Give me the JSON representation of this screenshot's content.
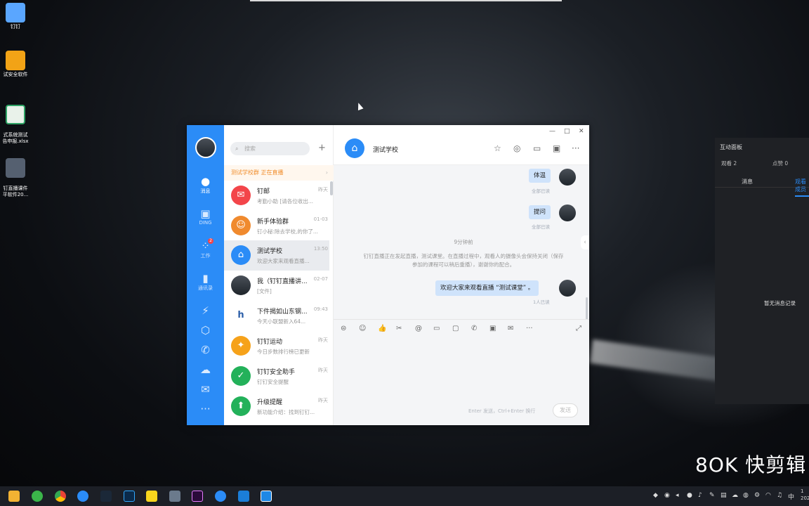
{
  "desktop": {
    "icons": [
      {
        "label": "钉钉",
        "icon": "feather-app-icon",
        "color": "#3a8cf7"
      },
      {
        "label": "试安全软件",
        "icon": "shield-app-icon",
        "color": "#f2a316"
      },
      {
        "label": "式系统测试\n告申报.xlsx",
        "icon": "spreadsheet-icon",
        "color": "#2ea365"
      },
      {
        "label": "钉直播课件\n平软件20...",
        "icon": "video-thumbnail-icon",
        "color": "#556070"
      }
    ]
  },
  "app": {
    "window_controls": {
      "minimize": "—",
      "maximize": "□",
      "close": "✕"
    },
    "rail": {
      "items": [
        {
          "label": "消息",
          "icon": "chat-bubble-icon",
          "active": true
        },
        {
          "label": "DING",
          "icon": "ding-icon",
          "active": false
        },
        {
          "label": "工作",
          "icon": "apps-grid-icon",
          "active": false,
          "badge": "2"
        },
        {
          "label": "通讯录",
          "icon": "contacts-icon",
          "active": false
        },
        {
          "label": "",
          "icon": "lightning-icon"
        },
        {
          "label": "",
          "icon": "hexagon-icon"
        },
        {
          "label": "",
          "icon": "phone-icon"
        },
        {
          "label": "",
          "icon": "cloud-icon"
        },
        {
          "label": "",
          "icon": "mail-icon"
        },
        {
          "label": "",
          "icon": "more-dots-icon"
        }
      ]
    },
    "search": {
      "placeholder": "搜索",
      "plus": "+"
    },
    "live_banner": {
      "text": "测试学校群 正在直播",
      "chevron": "›"
    },
    "conversations": [
      {
        "name": "钉邮",
        "time": "昨天",
        "preview": "考勤小助 [请各位收出...",
        "avatar_color": "#f3454a",
        "icon": "mail-icon",
        "glyph": "✉"
      },
      {
        "name": "新手体验群",
        "time": "01-03",
        "preview": "钉小秘:除去学校,的你了...",
        "avatar_color": "#f08a2e",
        "icon": "group-icon",
        "glyph": "☺"
      },
      {
        "name": "测试学校",
        "time": "13:50",
        "preview": "欢迎大家来观看直播...",
        "avatar_color": "#2b8cf7",
        "icon": "school-icon",
        "glyph": "⌂",
        "selected": true
      },
      {
        "name": "我（钉钉直播讲...",
        "time": "02-07",
        "preview": "[文件]",
        "avatar_color": "#3b4048",
        "icon": "user-avatar-icon",
        "glyph": ""
      },
      {
        "name": "下件揭如山东钢...",
        "time": "09:43",
        "preview": "今天小联盟新入64...",
        "avatar_color": "#ffffff",
        "icon": "company-logo-icon",
        "glyph": "h"
      },
      {
        "name": "钉钉运动",
        "time": "昨天",
        "preview": "今日步数排行榜已更新",
        "avatar_color": "#f6a21a",
        "icon": "running-icon",
        "glyph": "✦"
      },
      {
        "name": "钉钉安全助手",
        "time": "昨天",
        "preview": "钉钉安全提醒",
        "avatar_color": "#23b15a",
        "icon": "shield-check-icon",
        "glyph": "✓"
      },
      {
        "name": "升级提醒",
        "time": "昨天",
        "preview": "新功能介绍：找到钉钉...",
        "avatar_color": "#23b15a",
        "icon": "upgrade-arrow-icon",
        "glyph": "⬆"
      }
    ],
    "chat": {
      "title": "测试学校",
      "messages": [
        {
          "text": "体温",
          "status": "全部已读"
        },
        {
          "text": "提问",
          "status": "全部已读"
        }
      ],
      "time_separator": "9分钟前",
      "system_notice": "钉钉直播正在发起直播，测试课堂。在直播过程中，观看人的摄像头会保持关闭（保存参加的课程可以稍后重播），谢谢你的配合。",
      "welcome_message": {
        "text": "欢迎大家来观看直播 “测试课堂” 。",
        "status": "1人已读"
      },
      "input_hint": "Enter 发送，Ctrl+Enter 换行",
      "send_label": "发送"
    }
  },
  "live_panel": {
    "title": "互动面板",
    "viewers": "观看 2",
    "likes": "点赞 0",
    "tabs": [
      "消息",
      "观看成员"
    ],
    "empty_text": "暂无消息记录"
  },
  "watermark": "8OK 快剪辑",
  "taskbar": {
    "tray_text": "中",
    "clock_line1": "1",
    "clock_line2": "202"
  }
}
